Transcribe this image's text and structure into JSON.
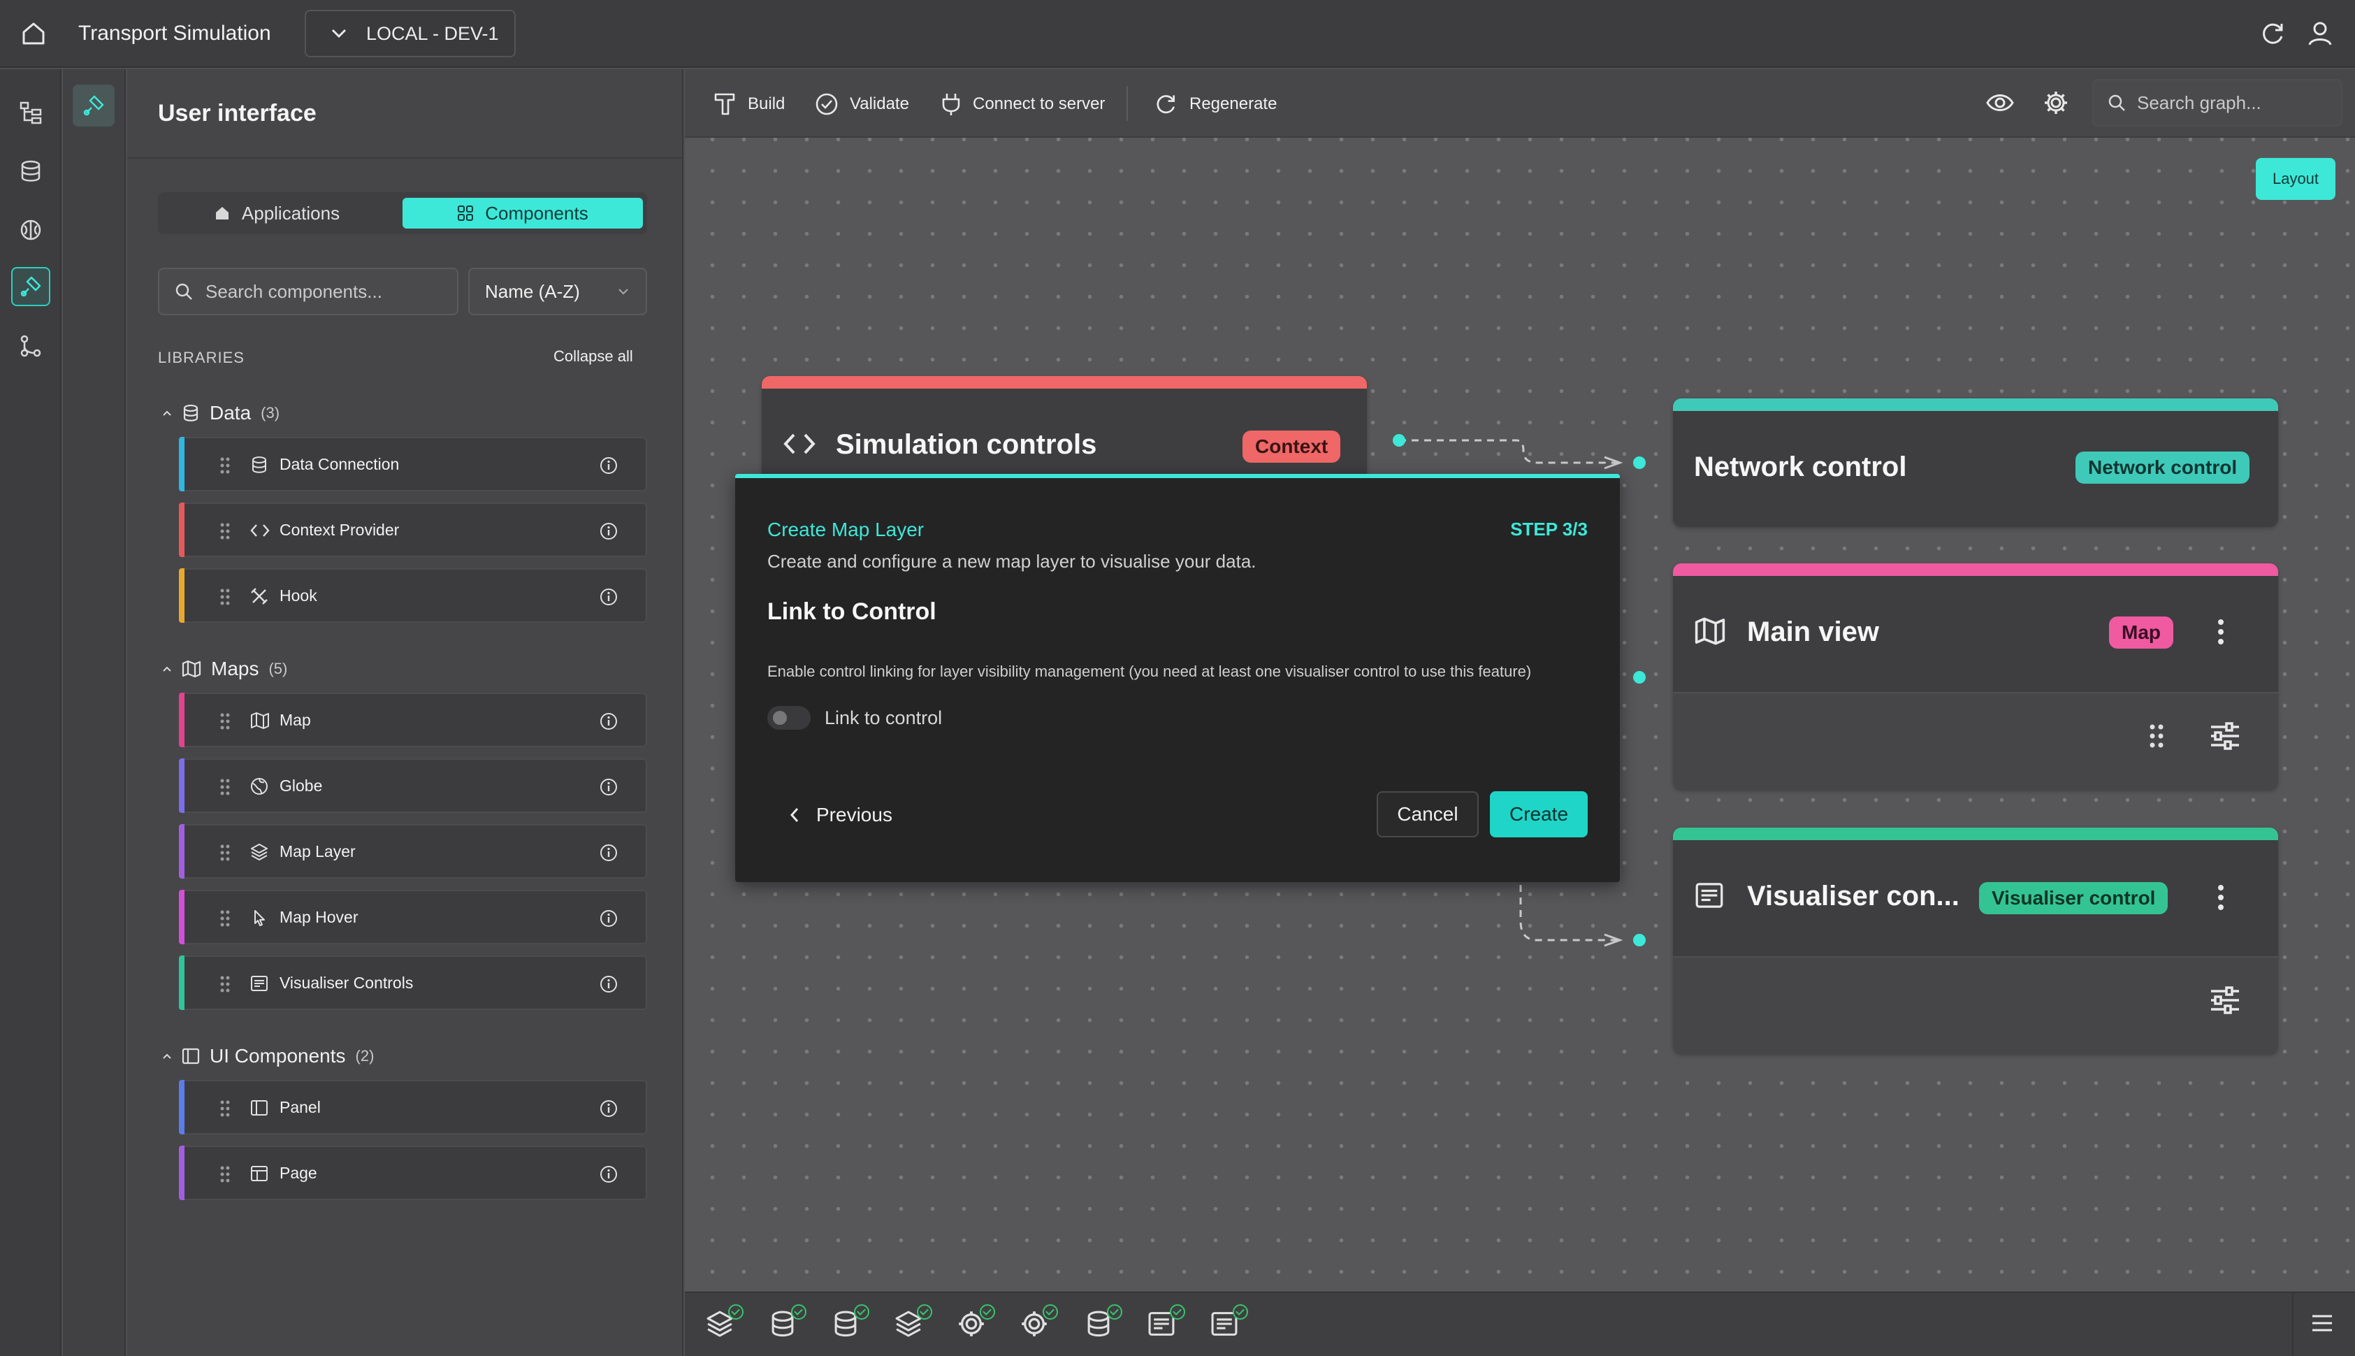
{
  "app": {
    "title": "Transport Simulation",
    "environment": "LOCAL - DEV-1"
  },
  "panel": {
    "title": "User interface",
    "tabs": [
      {
        "label": "Applications",
        "icon": "home-icon"
      },
      {
        "label": "Components",
        "icon": "grid-icon",
        "active": true
      }
    ],
    "search_placeholder": "Search components...",
    "sort_value": "Name (A-Z)",
    "libraries_label": "LIBRARIES",
    "collapse_all": "Collapse all",
    "groups": [
      {
        "name": "Data",
        "count": "(3)",
        "icon": "database-icon",
        "items": [
          {
            "label": "Data Connection",
            "icon": "database-icon",
            "color": "#2fb7e0"
          },
          {
            "label": "Context Provider",
            "icon": "code-icon",
            "color": "#e45a5a"
          },
          {
            "label": "Hook",
            "icon": "tools-icon",
            "color": "#e8a830"
          }
        ]
      },
      {
        "name": "Maps",
        "count": "(5)",
        "icon": "map-icon",
        "items": [
          {
            "label": "Map",
            "icon": "map-icon",
            "color": "#e3428e"
          },
          {
            "label": "Globe",
            "icon": "globe-icon",
            "color": "#7b6ee8"
          },
          {
            "label": "Map Layer",
            "icon": "layers-icon",
            "color": "#a15fe0"
          },
          {
            "label": "Map Hover",
            "icon": "pointer-icon",
            "color": "#d24fd8"
          },
          {
            "label": "Visualiser Controls",
            "icon": "list-icon",
            "color": "#2fc49b"
          }
        ]
      },
      {
        "name": "UI Components",
        "count": "(2)",
        "icon": "panel-icon",
        "items": [
          {
            "label": "Panel",
            "icon": "panel-icon",
            "color": "#5b7de8"
          },
          {
            "label": "Page",
            "icon": "page-icon",
            "color": "#a15fe0"
          }
        ]
      }
    ]
  },
  "toolbar": {
    "build": "Build",
    "validate": "Validate",
    "connect": "Connect to server",
    "regenerate": "Regenerate",
    "search_placeholder": "Search graph...",
    "layout": "Layout"
  },
  "nodes": {
    "simulation": {
      "title": "Simulation controls",
      "badge": "Context",
      "color": "#ef6767"
    },
    "network": {
      "title": "Network control",
      "badge": "Network control",
      "color": "#3fc9b8"
    },
    "main_view": {
      "title": "Main view",
      "badge": "Map",
      "color": "#ef5aa0"
    },
    "visualiser": {
      "title": "Visualiser con...",
      "badge": "Visualiser control",
      "color": "#34c493"
    }
  },
  "modal": {
    "title": "Create Map Layer",
    "step": "STEP 3/3",
    "description": "Create and configure a new map layer to visualise your data.",
    "heading": "Link to Control",
    "help": "Enable control linking for layer visibility management (you need at least one visualiser control to use this feature)",
    "toggle_label": "Link to control",
    "toggle_on": false,
    "previous": "Previous",
    "cancel": "Cancel",
    "create": "Create"
  },
  "bottom_bar": {
    "icons": [
      "layers-icon",
      "database-icon",
      "database-icon",
      "layers-icon",
      "gear-icon",
      "gear-icon",
      "database-icon",
      "list-icon",
      "list-icon"
    ]
  },
  "colors": {
    "accent": "#3de8d8",
    "success": "#37c46c"
  }
}
